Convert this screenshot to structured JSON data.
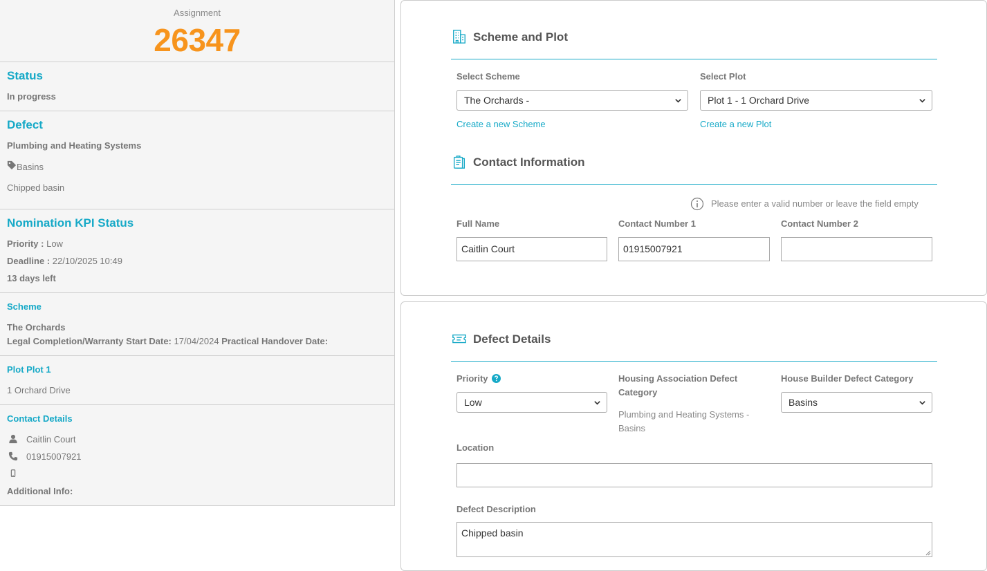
{
  "sidebar": {
    "assignment_label": "Assignment",
    "assignment_number": "26347",
    "status": {
      "heading": "Status",
      "value": "In progress"
    },
    "defect": {
      "heading": "Defect",
      "category": "Plumbing and Heating Systems",
      "tag": "Basins",
      "description": "Chipped basin"
    },
    "kpi": {
      "heading": "Nomination KPI Status",
      "priority_label": "Priority :",
      "priority_value": "Low",
      "deadline_label": "Deadline :",
      "deadline_value": "22/10/2025 10:49",
      "days_left": "13 days left"
    },
    "scheme": {
      "heading": "Scheme",
      "name": "The Orchards",
      "legal_label": "Legal Completion/Warranty Start Date:",
      "legal_value": "17/04/2024",
      "handover_label": "Practical Handover Date:"
    },
    "plot": {
      "heading": "Plot Plot 1",
      "address": "1 Orchard Drive"
    },
    "contact": {
      "heading": "Contact Details",
      "name": "Caitlin Court",
      "phone": "01915007921",
      "additional_label": "Additional Info:"
    }
  },
  "scheme_plot": {
    "title": "Scheme and Plot",
    "select_scheme_label": "Select Scheme",
    "select_scheme_value": "The Orchards -",
    "create_scheme_link": "Create a new Scheme",
    "select_plot_label": "Select Plot",
    "select_plot_value": "Plot 1 - 1 Orchard Drive",
    "create_plot_link": "Create a new Plot"
  },
  "contact_info": {
    "title": "Contact Information",
    "note": "Please enter a valid number or leave the field empty",
    "full_name_label": "Full Name",
    "full_name_value": "Caitlin Court",
    "contact1_label": "Contact Number 1",
    "contact1_value": "01915007921",
    "contact2_label": "Contact Number 2",
    "contact2_value": ""
  },
  "defect_details": {
    "title": "Defect Details",
    "priority_label": "Priority",
    "priority_value": "Low",
    "ha_category_label": "Housing Association Defect Category",
    "ha_category_value": "Plumbing and Heating Systems - Basins",
    "hb_category_label": "House Builder Defect Category",
    "hb_category_value": "Basins",
    "location_label": "Location",
    "location_value": "",
    "description_label": "Defect Description",
    "description_value": "Chipped basin"
  },
  "colors": {
    "accent": "#16a9c7",
    "assignment_number": "#f7941d"
  }
}
